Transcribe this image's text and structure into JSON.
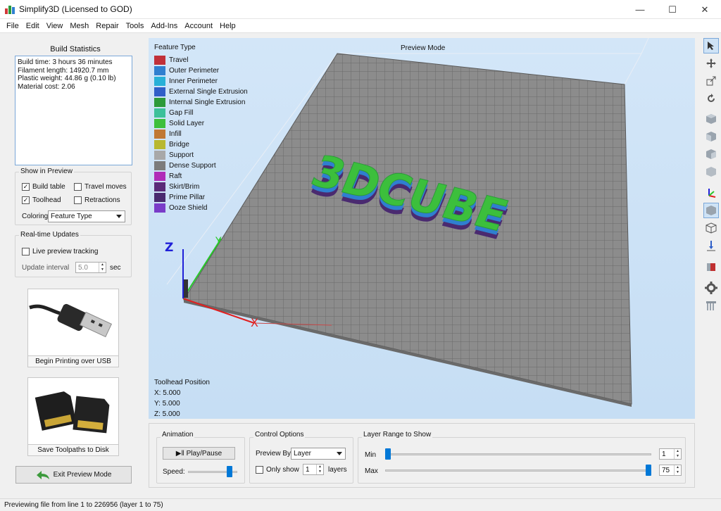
{
  "window": {
    "title": "Simplify3D (Licensed to GOD)",
    "controls": [
      "—",
      "☐",
      "✕"
    ]
  },
  "menu": [
    "File",
    "Edit",
    "View",
    "Mesh",
    "Repair",
    "Tools",
    "Add-Ins",
    "Account",
    "Help"
  ],
  "build_stats": {
    "title": "Build Statistics",
    "lines": [
      "Build time: 3 hours 36 minutes",
      "Filament length: 14920.7 mm",
      "Plastic weight: 44.86 g (0.10 lb)",
      "Material cost: 2.06"
    ]
  },
  "show_in_preview": {
    "title": "Show in Preview",
    "build_table": {
      "label": "Build table",
      "checked": true
    },
    "travel_moves": {
      "label": "Travel moves",
      "checked": false
    },
    "toolhead": {
      "label": "Toolhead",
      "checked": true
    },
    "retractions": {
      "label": "Retractions",
      "checked": false
    },
    "coloring_label": "Coloring",
    "coloring_value": "Feature Type"
  },
  "realtime": {
    "title": "Real-time Updates",
    "live_label": "Live preview tracking",
    "live_checked": false,
    "interval_label": "Update interval",
    "interval_value": "5.0",
    "interval_unit": "sec"
  },
  "usb_card": {
    "caption": "Begin Printing over USB"
  },
  "sd_card": {
    "caption": "Save Toolpaths to Disk"
  },
  "exit_button": "Exit Preview Mode",
  "viewport": {
    "mode_label": "Preview Mode",
    "legend_title": "Feature Type",
    "legend": [
      {
        "label": "Travel",
        "color": "#c0303a"
      },
      {
        "label": "Outer Perimeter",
        "color": "#2f7fd0"
      },
      {
        "label": "Inner Perimeter",
        "color": "#28b0d8"
      },
      {
        "label": "External Single Extrusion",
        "color": "#2f5fc8"
      },
      {
        "label": "Internal Single Extrusion",
        "color": "#2c9a3a"
      },
      {
        "label": "Gap Fill",
        "color": "#3cc09a"
      },
      {
        "label": "Solid Layer",
        "color": "#3cbf3c"
      },
      {
        "label": "Infill",
        "color": "#c07834"
      },
      {
        "label": "Bridge",
        "color": "#b8b830"
      },
      {
        "label": "Support",
        "color": "#a8a8a8"
      },
      {
        "label": "Dense Support",
        "color": "#7c7c7c"
      },
      {
        "label": "Raft",
        "color": "#b02cb8"
      },
      {
        "label": "Skirt/Brim",
        "color": "#5a2a78"
      },
      {
        "label": "Prime Pillar",
        "color": "#4a2a70"
      },
      {
        "label": "Ooze Shield",
        "color": "#7a3cc8"
      }
    ],
    "toolhead_title": "Toolhead Position",
    "toolhead_x": "X: 5.000",
    "toolhead_y": "Y: 5.000",
    "toolhead_z": "Z: 5.000",
    "model_text": "3DCUBE",
    "axis_x": "X",
    "axis_y": "Y",
    "axis_z": "Z"
  },
  "animation": {
    "title": "Animation",
    "play_label": "Play/Pause",
    "speed_label": "Speed:",
    "speed_fraction": 0.88
  },
  "control_options": {
    "title": "Control Options",
    "preview_by_label": "Preview By",
    "preview_by_value": "Layer",
    "only_show_label": "Only show",
    "only_show_checked": false,
    "only_show_value": "1",
    "layers_label": "layers"
  },
  "layer_range": {
    "title": "Layer Range to Show",
    "min_label": "Min",
    "max_label": "Max",
    "min_value": "1",
    "max_value": "75",
    "min_fraction": 0.0,
    "max_fraction": 1.0
  },
  "status": "Previewing file from line 1 to 226956 (layer 1 to 75)"
}
